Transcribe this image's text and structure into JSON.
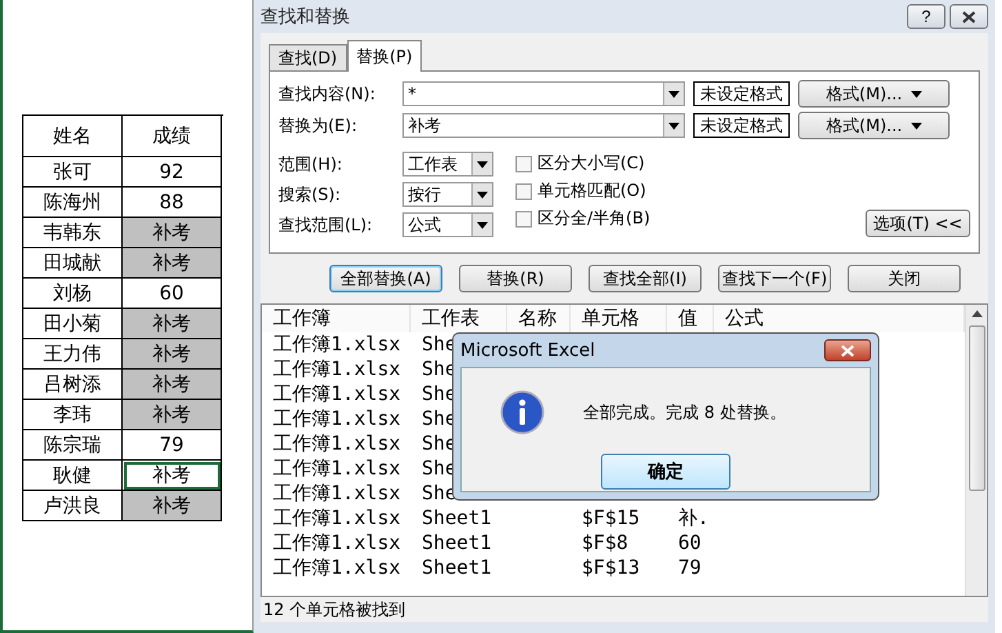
{
  "sheet": {
    "columns": [
      "姓名",
      "成绩"
    ],
    "rows": [
      {
        "name": "张可",
        "score": "92",
        "shaded": false,
        "selected": false
      },
      {
        "name": "陈海州",
        "score": "88",
        "shaded": false,
        "selected": false
      },
      {
        "name": "韦韩东",
        "score": "补考",
        "shaded": true,
        "selected": false
      },
      {
        "name": "田城献",
        "score": "补考",
        "shaded": true,
        "selected": false
      },
      {
        "name": "刘杨",
        "score": "60",
        "shaded": false,
        "selected": false
      },
      {
        "name": "田小菊",
        "score": "补考",
        "shaded": true,
        "selected": false
      },
      {
        "name": "王力伟",
        "score": "补考",
        "shaded": true,
        "selected": false
      },
      {
        "name": "吕树添",
        "score": "补考",
        "shaded": true,
        "selected": false
      },
      {
        "name": "李玮",
        "score": "补考",
        "shaded": true,
        "selected": false
      },
      {
        "name": "陈宗瑞",
        "score": "79",
        "shaded": false,
        "selected": false
      },
      {
        "name": "耿健",
        "score": "补考",
        "shaded": false,
        "selected": true
      },
      {
        "name": "卢洪良",
        "score": "补考",
        "shaded": true,
        "selected": false
      }
    ]
  },
  "dialog": {
    "title": "查找和替换",
    "help": "?",
    "tabs": [
      {
        "label": "查找(D)",
        "selected": false
      },
      {
        "label": "替换(P)",
        "selected": true
      }
    ],
    "find_label": "查找内容(N):",
    "find_value": "*",
    "find_format": "未设定格式",
    "find_format_button": "格式(M)...",
    "replace_label": "替换为(E):",
    "replace_value": "补考",
    "replace_format": "未设定格式",
    "replace_format_button": "格式(M)...",
    "selects": [
      {
        "label": "范围(H):",
        "value": "工作表"
      },
      {
        "label": "搜索(S):",
        "value": "按行"
      },
      {
        "label": "查找范围(L):",
        "value": "公式"
      }
    ],
    "checkboxes": [
      {
        "label": "区分大小写(C)",
        "checked": false
      },
      {
        "label": "单元格匹配(O)",
        "checked": false
      },
      {
        "label": "区分全/半角(B)",
        "checked": false
      }
    ],
    "options_button": "选项(T) <<",
    "buttons": [
      {
        "label": "全部替换(A)",
        "selected": true
      },
      {
        "label": "替换(R)",
        "selected": false
      },
      {
        "label": "查找全部(I)",
        "selected": false
      },
      {
        "label": "查找下一个(F)",
        "selected": false
      },
      {
        "label": "关闭",
        "selected": false
      }
    ],
    "results": {
      "columns": [
        "工作簿",
        "工作表",
        "名称",
        "单元格",
        "值",
        "公式"
      ],
      "rows": [
        [
          "工作簿1.xlsx",
          "She"
        ],
        [
          "工作簿1.xlsx",
          "She"
        ],
        [
          "工作簿1.xlsx",
          "She"
        ],
        [
          "工作簿1.xlsx",
          "She"
        ],
        [
          "工作簿1.xlsx",
          "She"
        ],
        [
          "工作簿1.xlsx",
          "She"
        ],
        [
          "工作簿1.xlsx",
          "She"
        ],
        [
          "工作簿1.xlsx",
          "Sheet1",
          "",
          "$F$15",
          "补."
        ],
        [
          "工作簿1.xlsx",
          "Sheet1",
          "",
          "$F$8",
          "60"
        ],
        [
          "工作簿1.xlsx",
          "Sheet1",
          "",
          "$F$13",
          "79"
        ]
      ]
    },
    "status": "12 个单元格被找到"
  },
  "message_box": {
    "title": "Microsoft Excel",
    "message": "全部完成。完成 8 处替换。",
    "ok": "确定"
  }
}
